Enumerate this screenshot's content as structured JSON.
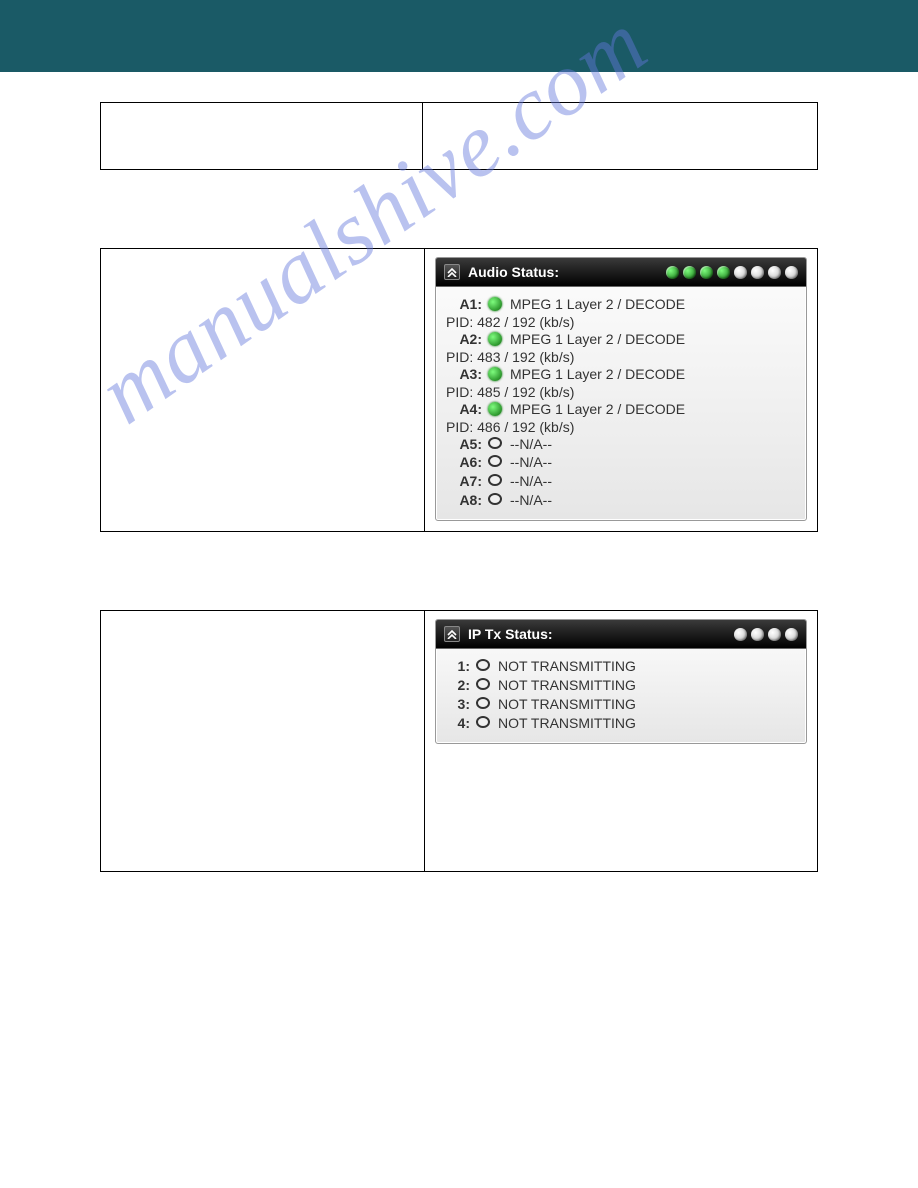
{
  "watermark": "manualshive.com",
  "audio_panel": {
    "title": "Audio Status:",
    "header_dots": [
      "green",
      "green",
      "green",
      "green",
      "white",
      "white",
      "white",
      "white"
    ],
    "rows": [
      {
        "label": "A1:",
        "status": "green",
        "line1": "MPEG 1 Layer 2 / DECODE",
        "line2": "PID: 482 / 192 (kb/s)"
      },
      {
        "label": "A2:",
        "status": "green",
        "line1": "MPEG 1 Layer 2 / DECODE",
        "line2": "PID: 483 / 192 (kb/s)"
      },
      {
        "label": "A3:",
        "status": "green",
        "line1": "MPEG 1 Layer 2 / DECODE",
        "line2": "PID: 485 / 192 (kb/s)"
      },
      {
        "label": "A4:",
        "status": "green",
        "line1": "MPEG 1 Layer 2 / DECODE",
        "line2": "PID: 486 / 192 (kb/s)"
      },
      {
        "label": "A5:",
        "status": "empty",
        "line1": "--N/A--",
        "line2": ""
      },
      {
        "label": "A6:",
        "status": "empty",
        "line1": "--N/A--",
        "line2": ""
      },
      {
        "label": "A7:",
        "status": "empty",
        "line1": "--N/A--",
        "line2": ""
      },
      {
        "label": "A8:",
        "status": "empty",
        "line1": "--N/A--",
        "line2": ""
      }
    ]
  },
  "iptx_panel": {
    "title": "IP Tx Status:",
    "header_dots": [
      "white",
      "white",
      "white",
      "white"
    ],
    "rows": [
      {
        "label": "1:",
        "status": "empty",
        "line1": "NOT TRANSMITTING"
      },
      {
        "label": "2:",
        "status": "empty",
        "line1": "NOT TRANSMITTING"
      },
      {
        "label": "3:",
        "status": "empty",
        "line1": "NOT TRANSMITTING"
      },
      {
        "label": "4:",
        "status": "empty",
        "line1": "NOT TRANSMITTING"
      }
    ]
  }
}
